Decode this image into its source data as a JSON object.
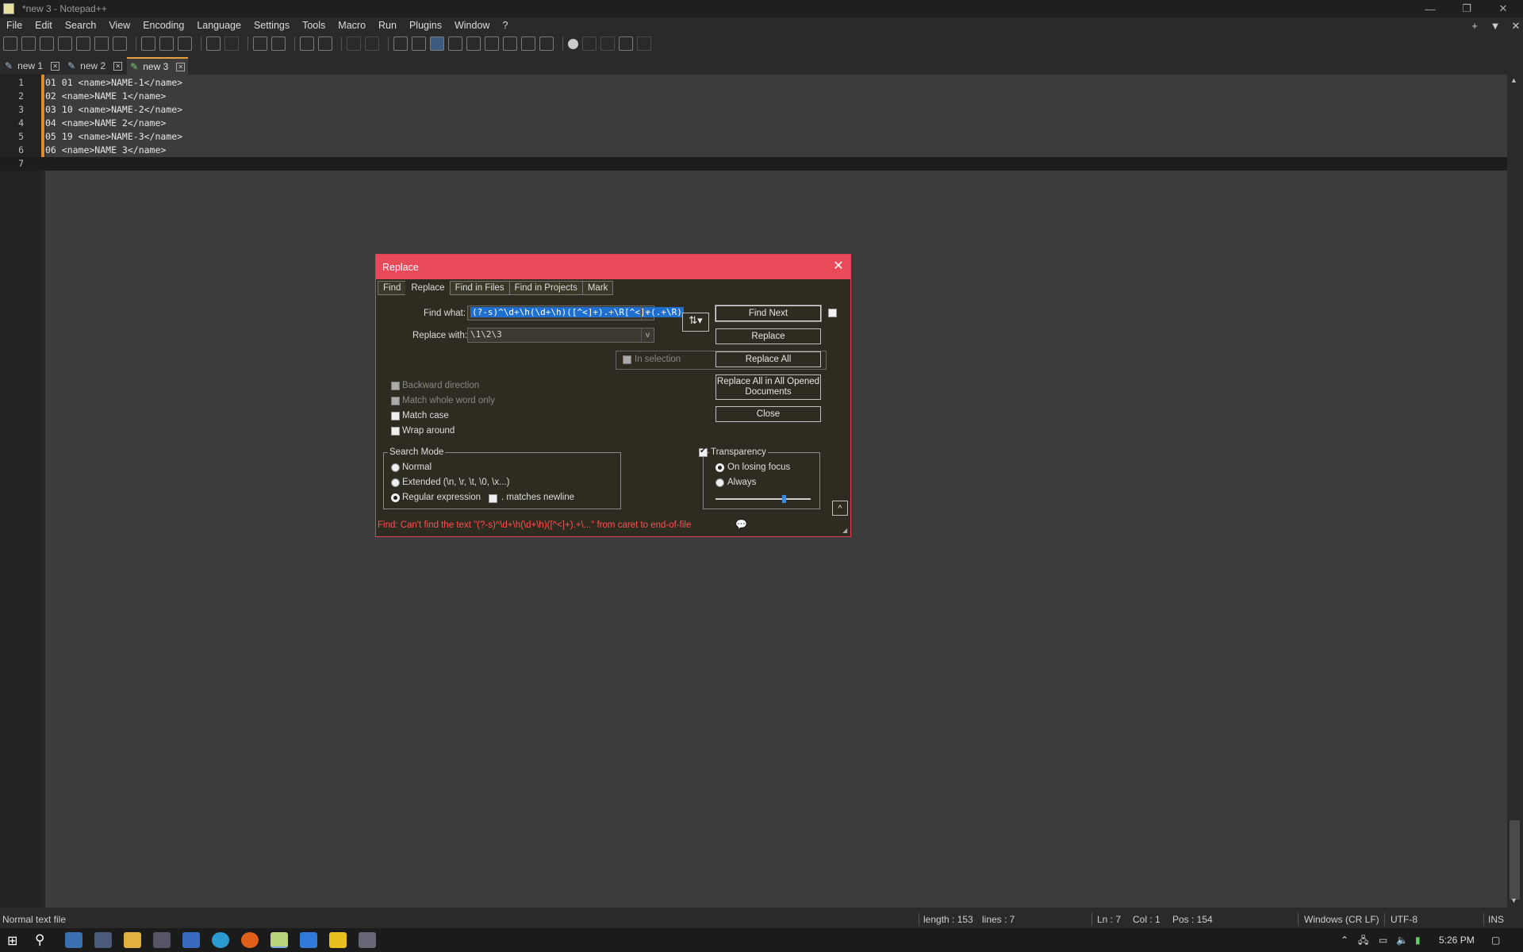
{
  "window": {
    "title": "*new 3 - Notepad++"
  },
  "menu": [
    "File",
    "Edit",
    "Search",
    "View",
    "Encoding",
    "Language",
    "Settings",
    "Tools",
    "Macro",
    "Run",
    "Plugins",
    "Window",
    "?"
  ],
  "menu_right": {
    "add": "+",
    "dropdown": "▼",
    "close": "✕"
  },
  "window_controls": {
    "min": "—",
    "max": "❐",
    "close": "✕"
  },
  "tabs": [
    {
      "label": "new 1",
      "active": false
    },
    {
      "label": "new 2",
      "active": false
    },
    {
      "label": "new 3",
      "active": true
    }
  ],
  "editor": {
    "lines": [
      {
        "num": "1",
        "text": "01 01 <name>NAME-1</name>"
      },
      {
        "num": "2",
        "text": "02 <name>NAME 1</name>"
      },
      {
        "num": "3",
        "text": "03 10 <name>NAME-2</name>"
      },
      {
        "num": "4",
        "text": "04 <name>NAME 2</name>"
      },
      {
        "num": "5",
        "text": "05 19 <name>NAME-3</name>"
      },
      {
        "num": "6",
        "text": "06 <name>NAME 3</name>"
      },
      {
        "num": "7",
        "text": ""
      }
    ]
  },
  "dialog": {
    "title": "Replace",
    "tabs": [
      "Find",
      "Replace",
      "Find in Files",
      "Find in Projects",
      "Mark"
    ],
    "find_what_label": "Find what:",
    "find_what_value": "(?-s)^\\d+\\h(\\d+\\h)([^<]+).+\\R[^<]+(.+\\R)",
    "replace_with_label": "Replace with:",
    "replace_with_value": "\\1\\2\\3",
    "in_selection": "In selection",
    "buttons": {
      "find_next": "Find Next",
      "replace": "Replace",
      "replace_all": "Replace All",
      "replace_all_opened": "Replace All in All Opened Documents",
      "close": "Close"
    },
    "options": {
      "backward": "Backward direction",
      "whole_word": "Match whole word only",
      "match_case": "Match case",
      "wrap_around": "Wrap around"
    },
    "search_mode": {
      "title": "Search Mode",
      "normal": "Normal",
      "extended": "Extended (\\n, \\r, \\t, \\0, \\x...)",
      "regex": "Regular expression",
      "matches_newline": ". matches newline",
      "selected": "regex"
    },
    "transparency": {
      "title": "Transparency",
      "checked": true,
      "on_losing_focus": "On losing focus",
      "always": "Always",
      "selected": "on_losing_focus",
      "level": 0.72
    },
    "status_message": "Find: Can't find the text \"(?-s)^\\d+\\h(\\d+\\h)([^<]+).+\\...\" from caret to end-of-file"
  },
  "statusbar": {
    "file_type": "Normal text file",
    "length": "length : 153",
    "lines": "lines : 7",
    "ln": "Ln : 7",
    "col": "Col : 1",
    "pos": "Pos : 154",
    "eol": "Windows (CR LF)",
    "encoding": "UTF-8",
    "mode": "INS"
  },
  "taskbar": {
    "time": "5:26 PM"
  }
}
